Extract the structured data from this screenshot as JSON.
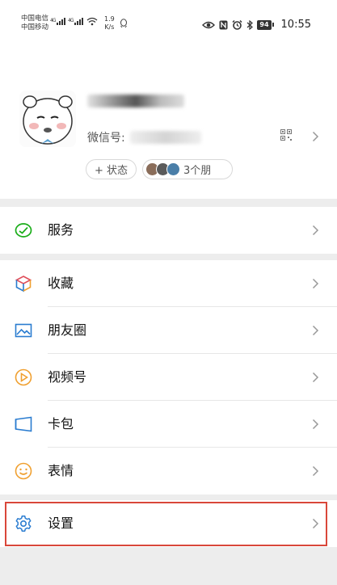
{
  "status_bar": {
    "carrier_1": "中国电信",
    "carrier_2": "中国移动",
    "network_1": "4G",
    "network_2": "4G",
    "speed_value": "1.9",
    "speed_unit": "K/s",
    "battery": "94",
    "time": "10:55"
  },
  "profile": {
    "nickname_visible": "",
    "wxid_label": "微信号:",
    "status_button": "+ 状态",
    "friends_label": "3个朋"
  },
  "menu": {
    "services": "服务",
    "favorites": "收藏",
    "moments": "朋友圈",
    "channels": "视频号",
    "cards": "卡包",
    "stickers": "表情",
    "settings": "设置"
  },
  "colors": {
    "services_icon": "#1aad19",
    "favorites_icon": "#f0a030",
    "moments_icon": "#2a7cd0",
    "channels_icon": "#f0a030",
    "cards_icon": "#2a7cd0",
    "stickers_icon": "#f0a030",
    "settings_icon": "#2a7cd0",
    "highlight_border": "#d9473a"
  }
}
